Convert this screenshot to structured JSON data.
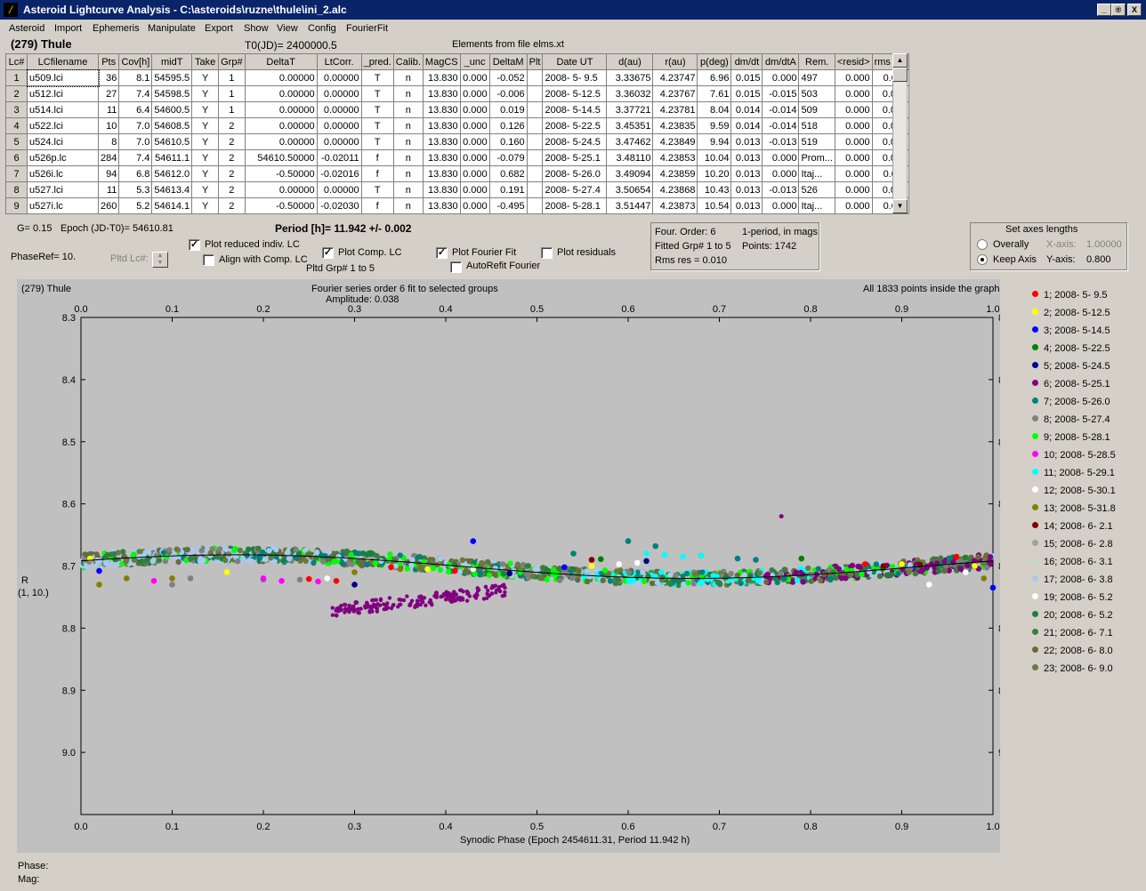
{
  "window": {
    "title": "Asteroid Lightcurve Analysis - C:\\asteroids\\ruzne\\thule\\ini_2.alc",
    "minimize": "_",
    "restore": "®",
    "close": "X"
  },
  "menu": [
    "Asteroid",
    "Import",
    "Ephemeris",
    "Manipulate",
    "Export",
    "Show",
    "View",
    "Config",
    "FourierFit"
  ],
  "header": {
    "asteroid": "(279) Thule",
    "t0": "T0(JD)= 2400000.5",
    "elements": "Elements from file elms.xt"
  },
  "table": {
    "columns": [
      "Lc#",
      "LCfilename",
      "Pts",
      "Cov[h]",
      "midT",
      "Take",
      "Grp#",
      "DeltaT",
      "LtCorr.",
      "_pred.",
      "Calib.",
      "MagCS",
      "_unc",
      "DeltaM",
      "Plt",
      "Date UT",
      "d(au)",
      "r(au)",
      "p(deg)",
      "dm/dt",
      "dm/dtA",
      "Rem.",
      "<resid>",
      "rms res"
    ],
    "rows": [
      [
        "1",
        "u509.lci",
        "36",
        "8.1",
        "54595.5",
        "Y",
        "1",
        "0.00000",
        "0.00000",
        "T",
        "n",
        "13.830",
        "0.000",
        "-0.052",
        "",
        "2008- 5- 9.5",
        "3.33675",
        "4.23747",
        "6.96",
        "0.015",
        "0.000",
        "497",
        "0.000",
        "0.011"
      ],
      [
        "2",
        "u512.lci",
        "27",
        "7.4",
        "54598.5",
        "Y",
        "1",
        "0.00000",
        "0.00000",
        "T",
        "n",
        "13.830",
        "0.000",
        "-0.006",
        "",
        "2008- 5-12.5",
        "3.36032",
        "4.23767",
        "7.61",
        "0.015",
        "-0.015",
        "503",
        "0.000",
        "0.019"
      ],
      [
        "3",
        "u514.lci",
        "11",
        "6.4",
        "54600.5",
        "Y",
        "1",
        "0.00000",
        "0.00000",
        "T",
        "n",
        "13.830",
        "0.000",
        "0.019",
        "",
        "2008- 5-14.5",
        "3.37721",
        "4.23781",
        "8.04",
        "0.014",
        "-0.014",
        "509",
        "0.000",
        "0.015"
      ],
      [
        "4",
        "u522.lci",
        "10",
        "7.0",
        "54608.5",
        "Y",
        "2",
        "0.00000",
        "0.00000",
        "T",
        "n",
        "13.830",
        "0.000",
        "0.126",
        "",
        "2008- 5-22.5",
        "3.45351",
        "4.23835",
        "9.59",
        "0.014",
        "-0.014",
        "518",
        "0.000",
        "0.014"
      ],
      [
        "5",
        "u524.lci",
        "8",
        "7.0",
        "54610.5",
        "Y",
        "2",
        "0.00000",
        "0.00000",
        "T",
        "n",
        "13.830",
        "0.000",
        "0.160",
        "",
        "2008- 5-24.5",
        "3.47462",
        "4.23849",
        "9.94",
        "0.013",
        "-0.013",
        "519",
        "0.000",
        "0.012"
      ],
      [
        "6",
        "u526p.lc",
        "284",
        "7.4",
        "54611.1",
        "Y",
        "2",
        "54610.50000",
        "-0.02011",
        "f",
        "n",
        "13.830",
        "0.000",
        "-0.079",
        "",
        "2008- 5-25.1",
        "3.48110",
        "4.23853",
        "10.04",
        "0.013",
        "0.000",
        "Prom...",
        "0.000",
        "0.010"
      ],
      [
        "7",
        "u526i.lc",
        "94",
        "6.8",
        "54612.0",
        "Y",
        "2",
        "-0.50000",
        "-0.02016",
        "f",
        "n",
        "13.830",
        "0.000",
        "0.682",
        "",
        "2008- 5-26.0",
        "3.49094",
        "4.23859",
        "10.20",
        "0.013",
        "0.000",
        "Itaj...",
        "0.000",
        "0.011"
      ],
      [
        "8",
        "u527.lci",
        "11",
        "5.3",
        "54613.4",
        "Y",
        "2",
        "0.00000",
        "0.00000",
        "T",
        "n",
        "13.830",
        "0.000",
        "0.191",
        "",
        "2008- 5-27.4",
        "3.50654",
        "4.23868",
        "10.43",
        "0.013",
        "-0.013",
        "526",
        "0.000",
        "0.008"
      ],
      [
        "9",
        "u527i.lc",
        "260",
        "5.2",
        "54614.1",
        "Y",
        "2",
        "-0.50000",
        "-0.02030",
        "f",
        "n",
        "13.830",
        "0.000",
        "-0.495",
        "",
        "2008- 5-28.1",
        "3.51447",
        "4.23873",
        "10.54",
        "0.013",
        "0.000",
        "Itaj...",
        "0.000",
        "0.011"
      ]
    ]
  },
  "controls": {
    "g": "G= 0.15",
    "epoch": "Epoch (JD-T0)= 54610.81",
    "period": "Period [h]= 11.942 +/- 0.002",
    "phaseref": "PhaseRef= 10.",
    "pltd_lc": "Pltd Lc#:",
    "plot_reduced": "Plot reduced indiv. LC",
    "align_comp": "Align with Comp. LC",
    "plot_comp": "Plot Comp. LC",
    "pltd_grp": "Pltd Grp#  1   to   5",
    "plot_fourier": "Plot Fourier Fit",
    "autorefit": "AutoRefit Fourier",
    "plot_residuals": "Plot residuals",
    "check": "✓"
  },
  "fourier_info": {
    "order": "Four. Order:  6",
    "mode": "1-period, in mags",
    "fitted": "Fitted Grp# 1 to 5",
    "points": "Points: 1742",
    "rms": "Rms res      = 0.010"
  },
  "axes_panel": {
    "title": "Set axes lengths",
    "overally": "Overally",
    "keep_axis": "Keep Axis",
    "xaxis_label": "X-axis:",
    "xaxis_val": "1.00000",
    "yaxis_label": "Y-axis:",
    "yaxis_val": "0.800"
  },
  "plot": {
    "object": "(279) Thule",
    "caption1": "Fourier series order 6 fit to selected groups",
    "caption2": "Amplitude: 0.038",
    "points_info": "All 1833 points inside the graph",
    "xlabel": "Synodic Phase (Epoch 2454611.31, Period 11.942 h)",
    "ylabel1": "R",
    "ylabel2": "(1, 10.)"
  },
  "chart_data": {
    "type": "scatter",
    "xlim": [
      0.0,
      1.0
    ],
    "ylim": [
      8.3,
      9.1
    ],
    "y_inverted": true,
    "x_ticks": [
      "0.0",
      "0.1",
      "0.2",
      "0.3",
      "0.4",
      "0.5",
      "0.6",
      "0.7",
      "0.8",
      "0.9",
      "1.0"
    ],
    "y_ticks": [
      "8.3",
      "8.4",
      "8.5",
      "8.6",
      "8.7",
      "8.8",
      "8.9",
      "9.0"
    ],
    "fourier_fit": {
      "mean": 8.701,
      "amplitude": 0.038,
      "min_phase": 0.67
    },
    "series": [
      {
        "name": "1; 2008- 5- 9.5",
        "color": "#ff0000",
        "x": [
          0.34,
          0.41,
          0.28,
          0.86,
          0.96,
          0.25
        ],
        "y": [
          8.702,
          8.708,
          8.724,
          8.697,
          8.685,
          8.721
        ]
      },
      {
        "name": "2; 2008- 5-12.5",
        "color": "#ffff00",
        "x": [
          0.01,
          0.16,
          0.38,
          0.56,
          0.9,
          0.98
        ],
        "y": [
          8.688,
          8.71,
          8.705,
          8.7,
          8.697,
          8.7
        ]
      },
      {
        "name": "3; 2008- 5-14.5",
        "color": "#0000ff",
        "x": [
          0.43,
          0.02,
          0.53,
          1.0
        ],
        "y": [
          8.66,
          8.708,
          8.702,
          8.735
        ]
      },
      {
        "name": "4; 2008- 5-22.5",
        "color": "#008000",
        "x": [
          0.57,
          0.68,
          0.79,
          0.88
        ],
        "y": [
          8.689,
          8.683,
          8.688,
          8.703
        ]
      },
      {
        "name": "5; 2008- 5-24.5",
        "color": "#00008b",
        "x": [
          0.3,
          0.47,
          0.62
        ],
        "y": [
          8.73,
          8.712,
          8.692
        ]
      },
      {
        "name": "6; 2008- 5-25.1",
        "color": "#800080",
        "x": [],
        "y": []
      },
      {
        "name": "7; 2008- 5-26.0",
        "color": "#008080",
        "x": [
          0.54,
          0.6,
          0.63,
          0.72,
          0.74
        ],
        "y": [
          8.68,
          8.66,
          8.668,
          8.688,
          8.69
        ]
      },
      {
        "name": "8; 2008- 5-27.4",
        "color": "#808080",
        "x": [
          0.1,
          0.12,
          0.2,
          0.24,
          0.27
        ],
        "y": [
          8.73,
          8.72,
          8.722,
          8.722,
          8.72
        ]
      },
      {
        "name": "9; 2008- 5-28.1",
        "color": "#00ff00",
        "x": [],
        "y": []
      },
      {
        "name": "10; 2008- 5-28.5",
        "color": "#ff00ff",
        "x": [
          0.08,
          0.2,
          0.22,
          0.26
        ],
        "y": [
          8.724,
          8.72,
          8.724,
          8.725
        ]
      },
      {
        "name": "11; 2008- 5-29.1",
        "color": "#00ffff",
        "x": [
          0.62,
          0.64,
          0.66,
          0.68
        ],
        "y": [
          8.68,
          8.682,
          8.685,
          8.683
        ]
      },
      {
        "name": "12; 2008- 5-30.1",
        "color": "#ffffff",
        "x": [
          0.27,
          0.43,
          0.59,
          0.61,
          0.93,
          0.97
        ],
        "y": [
          8.72,
          8.705,
          8.697,
          8.695,
          8.73,
          8.71
        ]
      },
      {
        "name": "13; 2008- 5-31.8",
        "color": "#808000",
        "x": [
          0.02,
          0.05,
          0.1,
          0.3,
          0.35,
          0.99
        ],
        "y": [
          8.73,
          8.72,
          8.72,
          8.71,
          8.705,
          8.72
        ]
      },
      {
        "name": "14; 2008- 6- 2.1",
        "color": "#800000",
        "x": [
          0.56,
          0.88,
          0.92
        ],
        "y": [
          8.69,
          8.7,
          8.698
        ]
      },
      {
        "name": "15; 2008- 6- 2.8",
        "color": "#a0a0a0",
        "x": [],
        "y": []
      },
      {
        "name": "16; 2008- 6- 3.1",
        "color": "#c0dcc0",
        "x": [],
        "y": []
      },
      {
        "name": "17; 2008- 6- 3.8",
        "color": "#a6caf0",
        "x": [],
        "y": []
      },
      {
        "name": "19; 2008- 6- 5.2",
        "color": "#ffffff",
        "x": [],
        "y": []
      },
      {
        "name": "20; 2008- 6- 5.2",
        "color": "#1e7f3c",
        "x": [],
        "y": []
      },
      {
        "name": "21; 2008- 6- 7.1",
        "color": "#3a7d44",
        "x": [],
        "y": []
      },
      {
        "name": "22; 2008- 6- 8.0",
        "color": "#6b6b3a",
        "x": [],
        "y": []
      },
      {
        "name": "23; 2008- 6- 9.0",
        "color": "#6b7a3a",
        "x": [],
        "y": []
      }
    ]
  },
  "status": {
    "phase": "Phase:",
    "mag": "Mag:"
  }
}
